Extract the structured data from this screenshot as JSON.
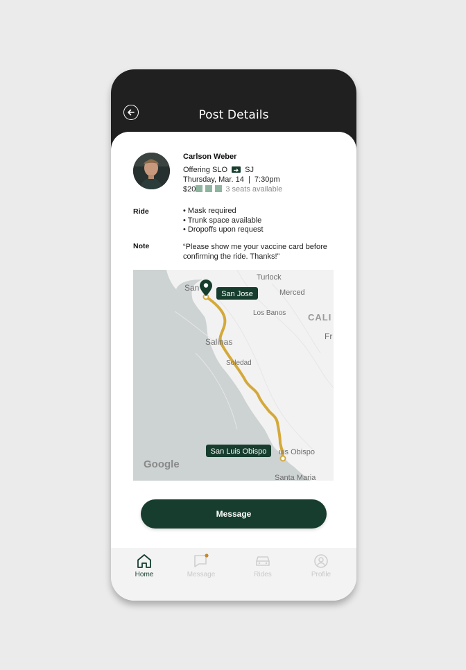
{
  "header": {
    "title": "Post Details"
  },
  "post": {
    "driver_name": "Carlson Weber",
    "offering_prefix": "Offering SLO",
    "offering_dest": "SJ",
    "datetime": "Thursday, Mar. 14  |  7:30pm",
    "price": "$20",
    "seats_total": 3,
    "seats_text": "3 seats available"
  },
  "ride": {
    "label": "Ride",
    "items": [
      "• Mask required",
      "• Trunk space available",
      "• Dropoffs upon request"
    ]
  },
  "note": {
    "label": "Note",
    "text": "“Please show me your vaccine card before confirming the ride. Thanks!”"
  },
  "map": {
    "origin_label": "San Jose",
    "destination_label": "San Luis Obispo",
    "places": {
      "turlock": "Turlock",
      "merced": "Merced",
      "los_banos": "Los Banos",
      "cali": "CALI",
      "fr": "Fr",
      "san": "San",
      "salinas": "Salinas",
      "soledad": "Soledad",
      "obispo": "uis Obispo",
      "santa_maria": "Santa Maria"
    },
    "logo": "Google",
    "route_color": "#d4a93a"
  },
  "actions": {
    "message_label": "Message"
  },
  "tabs": [
    {
      "label": "Home",
      "icon": "home-icon",
      "active": true
    },
    {
      "label": "Message",
      "icon": "chat-icon",
      "active": false
    },
    {
      "label": "Rides",
      "icon": "car-icon",
      "active": false
    },
    {
      "label": "Profile",
      "icon": "user-icon",
      "active": false
    }
  ],
  "colors": {
    "brand": "#163d2d",
    "accent": "#d4a93a",
    "header": "#202020",
    "badge": "#c7882a"
  }
}
